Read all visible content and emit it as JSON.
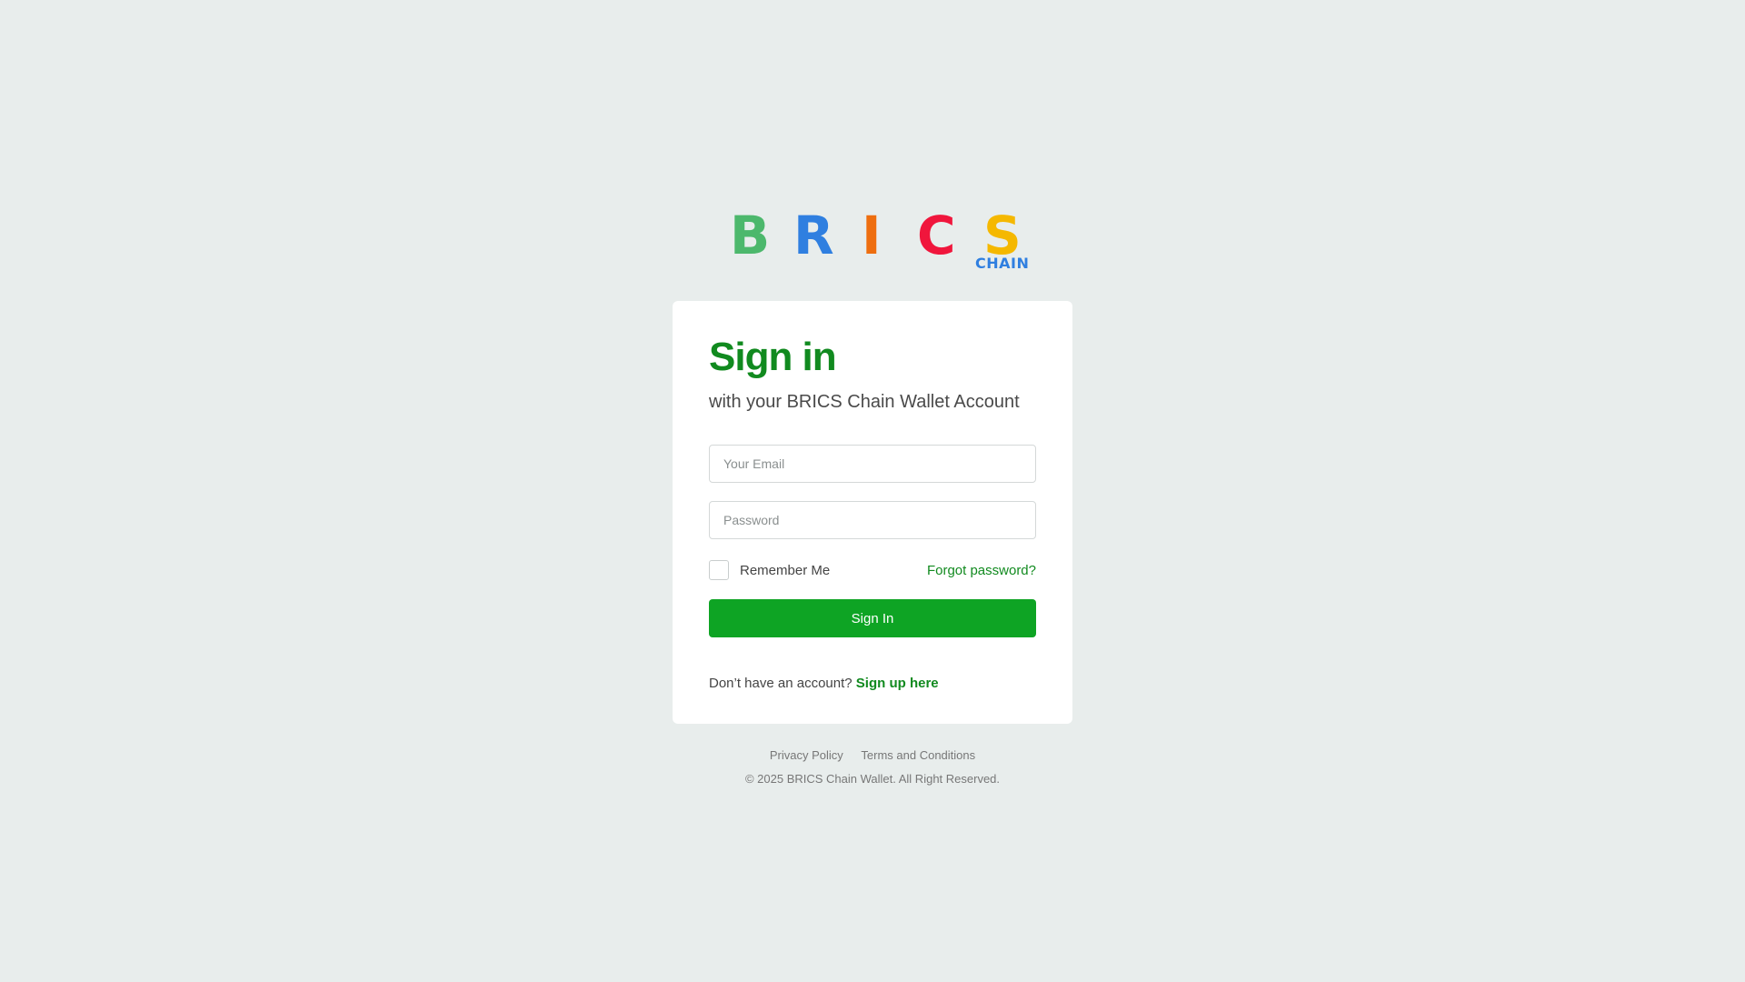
{
  "logo": {
    "letters": [
      {
        "char": "B",
        "color": "#4cb86c"
      },
      {
        "char": "R",
        "color": "#2f7fe0"
      },
      {
        "char": "I",
        "color": "#ee6e0f"
      },
      {
        "char": "C",
        "color": "#f0163c"
      },
      {
        "char": "S",
        "color": "#f5b800"
      }
    ],
    "sub": "CHAIN",
    "sub_color": "#2f7fe0"
  },
  "login": {
    "title": "Sign in",
    "subtitle": "with your BRICS Chain Wallet Account",
    "email_placeholder": "Your Email",
    "password_placeholder": "Password",
    "remember_label": "Remember Me",
    "remember_checked": false,
    "forgot_label": "Forgot password?",
    "submit_label": "Sign In",
    "signup_prompt": "Don’t have an account?",
    "signup_link": "Sign up here"
  },
  "footer": {
    "privacy": "Privacy Policy",
    "terms": "Terms and Conditions",
    "copyright": "© 2025 BRICS Chain Wallet. All Right Reserved."
  },
  "colors": {
    "brand_green": "#0ea424",
    "title_green": "#118a1f",
    "link_green": "#118a1f",
    "background": "#e8edec"
  }
}
